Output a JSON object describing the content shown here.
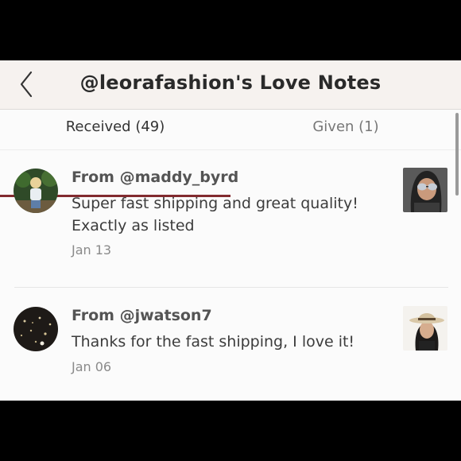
{
  "header": {
    "title": "@leorafashion's Love Notes",
    "back_icon": "chevron-left-icon"
  },
  "tabs": [
    {
      "label": "Received (49)",
      "active": true
    },
    {
      "label": "Given (1)",
      "active": false
    }
  ],
  "colors": {
    "accent": "#822b2f",
    "header_bg": "#f6f2ef",
    "page_bg": "#fbfbfb"
  },
  "notes": [
    {
      "from": "From @maddy_byrd",
      "text": "Super fast shipping and great quality! Exactly as listed",
      "date": "Jan 13"
    },
    {
      "from": "From @jwatson7",
      "text": "Thanks for the fast shipping, I love it!",
      "date": "Jan 06"
    }
  ]
}
